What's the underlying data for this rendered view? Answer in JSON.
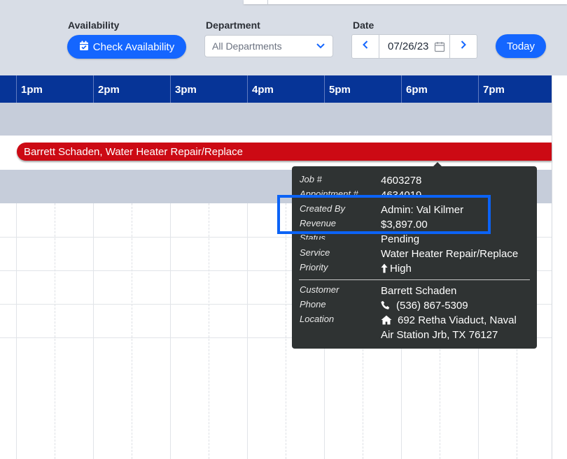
{
  "toolbar": {
    "availability_label": "Availability",
    "check_availability": "Check Availability",
    "department_label": "Department",
    "department_value": "All Departments",
    "date_label": "Date",
    "date_value": "07/26/23",
    "today": "Today"
  },
  "timeline": {
    "hours": [
      "1pm",
      "2pm",
      "3pm",
      "4pm",
      "5pm",
      "6pm",
      "7pm"
    ]
  },
  "appointment": {
    "bar_label": "Barrett Schaden, Water Heater Repair/Replace",
    "bar_color": "#cc0a14"
  },
  "tooltip": {
    "job_label": "Job #",
    "job_value": "4603278",
    "appointment_label": "Appointment #",
    "appointment_value": "4634019",
    "created_by_label": "Created By",
    "created_by_value": "Admin: Val Kilmer",
    "revenue_label": "Revenue",
    "revenue_value": "$3,897.00",
    "status_label": "Status",
    "status_value": "Pending",
    "service_label": "Service",
    "service_value": "Water Heater Repair/Replace",
    "priority_label": "Priority",
    "priority_value": "High",
    "customer_label": "Customer",
    "customer_value": "Barrett Schaden",
    "phone_label": "Phone",
    "phone_value": "(536) 867-5309",
    "location_label": "Location",
    "location_line1": "692 Retha Viaduct, Naval",
    "location_line2": "Air Station Jrb, TX 76127"
  },
  "colors": {
    "accent": "#1466ff",
    "header": "#063497",
    "highlight": "#0b63f6"
  },
  "icons": {
    "check_availability": "calendar-check-icon",
    "department": "chevron-down-icon",
    "date_prev": "chevron-left-icon",
    "date_next": "chevron-right-icon",
    "date_picker": "calendar-icon",
    "priority": "arrow-up-icon",
    "phone": "phone-icon",
    "location": "home-icon"
  }
}
